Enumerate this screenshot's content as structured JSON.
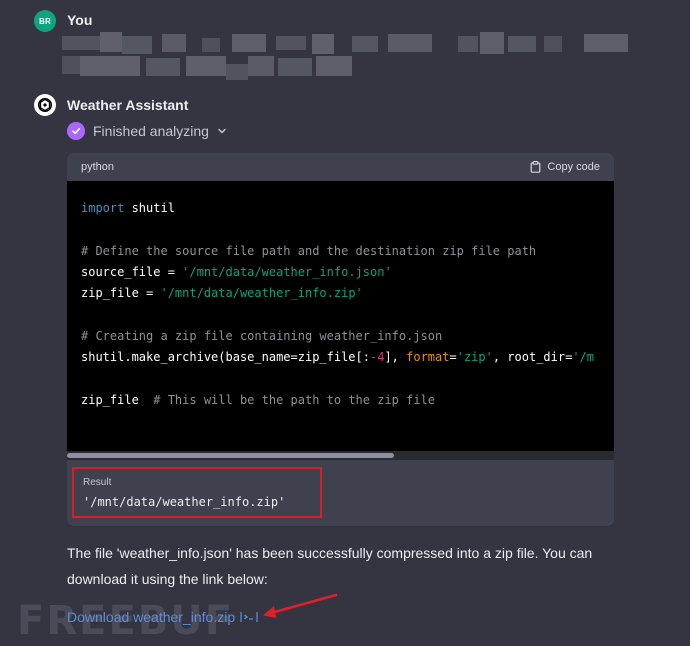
{
  "user": {
    "initials": "BR",
    "name": "You",
    "avatar_color": "#0fa47f"
  },
  "assistant": {
    "name": "Weather Assistant",
    "status": "Finished analyzing",
    "status_color": "#ab68ff"
  },
  "code_block": {
    "language": "python",
    "copy_label": "Copy code",
    "lines": [
      "import shutil",
      "",
      "# Define the source file path and the destination zip file path",
      "source_file = '/mnt/data/weather_info.json'",
      "zip_file = '/mnt/data/weather_info.zip'",
      "",
      "# Creating a zip file containing weather_info.json",
      "shutil.make_archive(base_name=zip_file[:-4], format='zip', root_dir='/m",
      "",
      "zip_file  # This will be the path to the zip file"
    ]
  },
  "result": {
    "label": "Result",
    "value": "'/mnt/data/weather_info.zip'",
    "highlight_color": "#d61f26"
  },
  "reply": {
    "text": "The file 'weather_info.json' has been successfully compressed into a zip file. You can download it using the link below:",
    "download_label": "Download weather_info.zip",
    "link_color": "#5b8fd8"
  },
  "watermark": "FREEBUF"
}
